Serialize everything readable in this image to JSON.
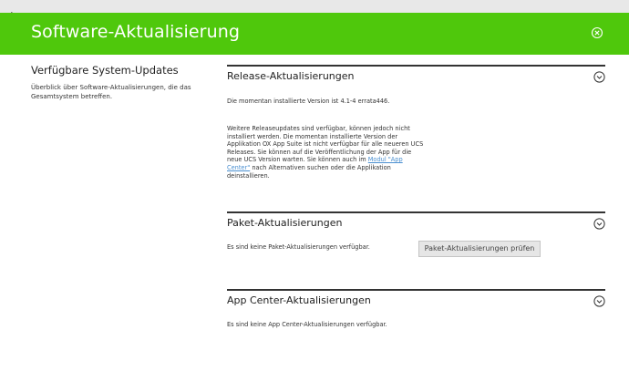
{
  "window": {
    "title": "Software-Aktualisierung"
  },
  "sidebar": {
    "title": "Verfügbare System-Updates",
    "description_line1": "Überblick über Software-Aktualisierungen, die das",
    "description_line2": "Gesamtsystem betreffen."
  },
  "sections": {
    "release": {
      "title": "Release-Aktualisierungen",
      "installed_version": "Die momentan installierte Version ist 4.1-4 errata446.",
      "warning_line1": "Weitere Releaseupdates sind verfügbar, können jedoch nicht",
      "warning_line2": "installiert werden. Die momentan installierte Version der",
      "warning_line3": "Applikation OX App Suite ist nicht verfügbar für alle neueren UCS",
      "warning_line4": "Releases. Sie können auf die Veröffentlichung der App für die",
      "warning_line5_prefix": "neue UCS Version warten. Sie können auch im ",
      "warning_link_part1": "Modul \"App",
      "warning_link_part2": "Center\"",
      "warning_line6_suffix": " nach Alternativen suchen oder die Applikation",
      "warning_line7": "deinstallieren."
    },
    "package": {
      "title": "Paket-Aktualisierungen",
      "status": "Es sind keine Paket-Aktualisierungen verfügbar.",
      "check_button": "Paket-Aktualisierungen prüfen"
    },
    "appcenter": {
      "title": "App Center-Aktualisierungen",
      "status": "Es sind keine App Center-Aktualisierungen verfügbar."
    }
  },
  "colors": {
    "header_bg": "#4fc80c",
    "link": "#4a8fd0"
  },
  "icons": {
    "close": "close-circle-icon",
    "expand": "chevron-down-circle-icon",
    "cursor": "mouse-pointer-icon"
  }
}
